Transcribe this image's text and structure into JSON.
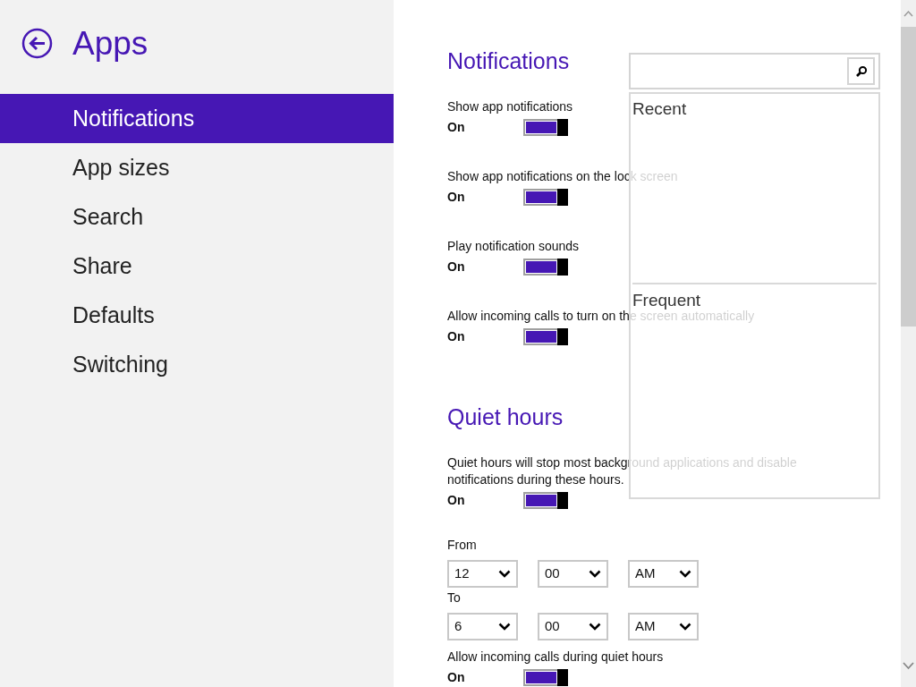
{
  "header": {
    "title": "Apps"
  },
  "nav": [
    {
      "label": "Notifications",
      "selected": true
    },
    {
      "label": "App sizes",
      "selected": false
    },
    {
      "label": "Search",
      "selected": false
    },
    {
      "label": "Share",
      "selected": false
    },
    {
      "label": "Defaults",
      "selected": false
    },
    {
      "label": "Switching",
      "selected": false
    }
  ],
  "sections": [
    {
      "title": "Notifications",
      "items": [
        {
          "kind": "toggle",
          "label": "Show app notifications",
          "state_text": "On",
          "on": true
        },
        {
          "kind": "toggle",
          "label": "Show app notifications on the lock screen",
          "state_text": "On",
          "on": true
        },
        {
          "kind": "toggle",
          "label": "Play notification sounds",
          "state_text": "On",
          "on": true
        },
        {
          "kind": "toggle",
          "label": "Allow incoming calls to turn on the screen automatically",
          "state_text": "On",
          "on": true
        }
      ]
    },
    {
      "title": "Quiet hours",
      "items": [
        {
          "kind": "toggle",
          "label": "Quiet hours will stop most background applications and disable notifications during these hours.",
          "state_text": "On",
          "on": true
        },
        {
          "kind": "time",
          "label": "From",
          "values": [
            "12",
            "00",
            "AM"
          ]
        },
        {
          "kind": "time",
          "label": "To",
          "values": [
            "6",
            "00",
            "AM"
          ]
        },
        {
          "kind": "toggle",
          "label": "Allow incoming calls during quiet hours",
          "state_text": "On",
          "on": true
        }
      ]
    }
  ],
  "search_panel": {
    "recent_heading": "Recent",
    "frequent_heading": "Frequent"
  }
}
